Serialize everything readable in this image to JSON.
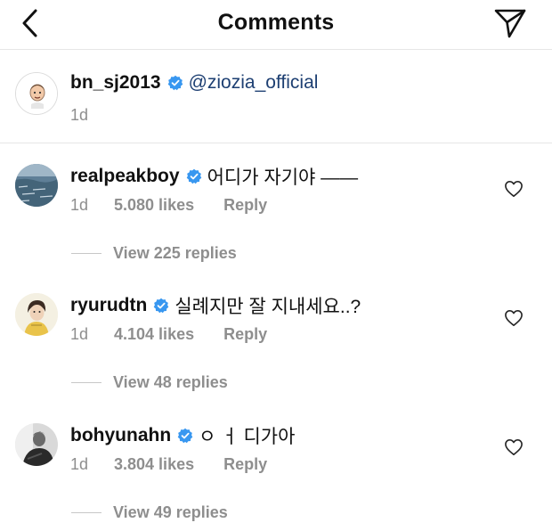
{
  "header": {
    "title": "Comments",
    "back_icon": "chevron-left-icon",
    "share_icon": "paper-plane-icon"
  },
  "caption": {
    "username": "bn_sj2013",
    "mention": "@ziozia_official",
    "time": "1d"
  },
  "comments": [
    {
      "username": "realpeakboy",
      "text": "어디가 자기야 ——",
      "time": "1d",
      "likes": "5.080 likes",
      "reply": "Reply",
      "view_replies": "View 225 replies"
    },
    {
      "username": "ryurudtn",
      "text": "실례지만 잘 지내세요..?",
      "time": "1d",
      "likes": "4.104 likes",
      "reply": "Reply",
      "view_replies": "View 48 replies"
    },
    {
      "username": "bohyunahn",
      "text": "ㅇ ㅓ 디가아",
      "time": "1d",
      "likes": "3.804 likes",
      "reply": "Reply",
      "view_replies": "View 49 replies"
    }
  ],
  "colors": {
    "verified": "#3897f0",
    "mention": "#1d3f72",
    "muted": "#8e8e8e",
    "divider": "#e6e6e6"
  }
}
